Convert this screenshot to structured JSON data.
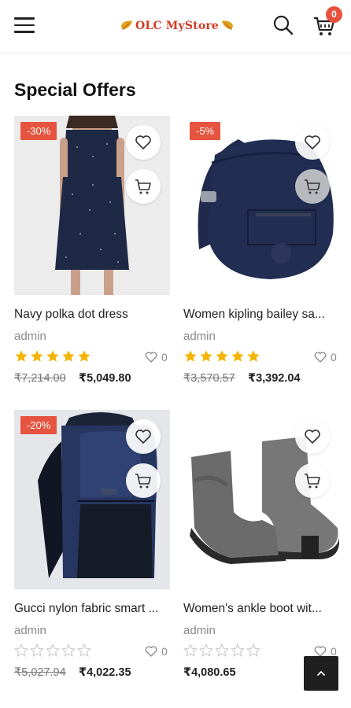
{
  "header": {
    "logo_text": "OLC MyStore",
    "cart_count": "0"
  },
  "section": {
    "title": "Special Offers"
  },
  "products": [
    {
      "name": "Navy polka dot dress",
      "author": "admin",
      "discount": "-30%",
      "rating": 5,
      "wishlist_count": "0",
      "old_price": "₹7,214.00",
      "price": "₹5,049.80",
      "image": "dress"
    },
    {
      "name": "Women kipling bailey sa...",
      "author": "admin",
      "discount": "-5%",
      "rating": 5,
      "wishlist_count": "0",
      "old_price": "₹3,570.57",
      "price": "₹3,392.04",
      "image": "bag"
    },
    {
      "name": "Gucci nylon fabric smart ...",
      "author": "admin",
      "discount": "-20%",
      "rating": 0,
      "wishlist_count": "0",
      "old_price": "₹5,027.94",
      "price": "₹4,022.35",
      "image": "backpack"
    },
    {
      "name": "Women's ankle boot wit...",
      "author": "admin",
      "discount": "",
      "rating": 0,
      "wishlist_count": "0",
      "old_price": "",
      "price": "₹4,080.65",
      "image": "boot"
    }
  ],
  "colors": {
    "accent": "#e6533f",
    "star": "#f5b400",
    "star_empty": "#cccccc"
  },
  "icons": {
    "menu": "hamburger-icon",
    "search": "search-icon",
    "cart": "cart-icon",
    "wishlist": "heart-icon",
    "add_to_cart": "cart-add-icon",
    "back_to_top": "chevron-up-icon"
  }
}
